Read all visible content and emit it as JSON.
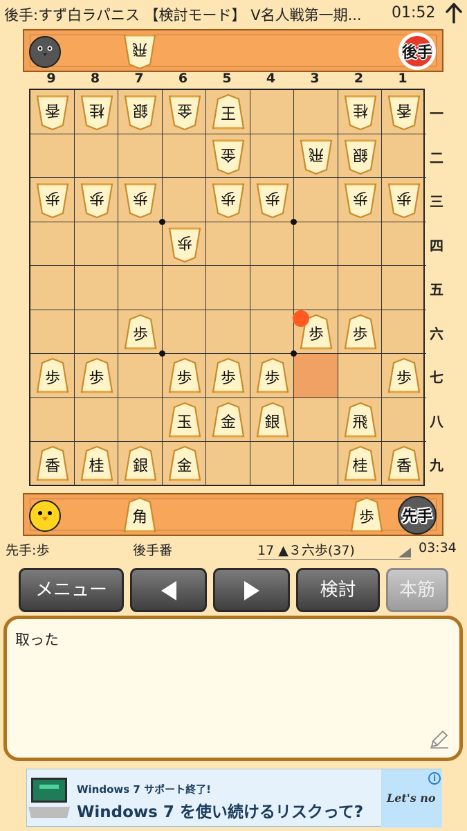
{
  "status_bar": {
    "title": "後手:すず白ラパニス 【検討モード】 V名人戦第一期...",
    "clock": "01:52"
  },
  "gote_hand": {
    "pieces": [
      "飛"
    ],
    "turn_label": "後手"
  },
  "sente_hand": {
    "pieces": [
      "角",
      "歩"
    ],
    "turn_label": "先手"
  },
  "board": {
    "files": [
      "9",
      "8",
      "7",
      "6",
      "5",
      "4",
      "3",
      "2",
      "1"
    ],
    "ranks": [
      "一",
      "二",
      "三",
      "四",
      "五",
      "六",
      "七",
      "八",
      "九"
    ],
    "highlight": {
      "file": 3,
      "rank": 7
    },
    "last_move_marker": {
      "file": 3,
      "rank": 6
    },
    "pieces": [
      {
        "file": 9,
        "rank": 1,
        "kanji": "香",
        "side": "gote"
      },
      {
        "file": 8,
        "rank": 1,
        "kanji": "桂",
        "side": "gote"
      },
      {
        "file": 7,
        "rank": 1,
        "kanji": "銀",
        "side": "gote"
      },
      {
        "file": 6,
        "rank": 1,
        "kanji": "金",
        "side": "gote"
      },
      {
        "file": 5,
        "rank": 1,
        "kanji": "王",
        "side": "sente"
      },
      {
        "file": 2,
        "rank": 1,
        "kanji": "桂",
        "side": "gote"
      },
      {
        "file": 1,
        "rank": 1,
        "kanji": "香",
        "side": "gote"
      },
      {
        "file": 5,
        "rank": 2,
        "kanji": "金",
        "side": "gote"
      },
      {
        "file": 3,
        "rank": 2,
        "kanji": "飛",
        "side": "gote"
      },
      {
        "file": 2,
        "rank": 2,
        "kanji": "銀",
        "side": "gote"
      },
      {
        "file": 9,
        "rank": 3,
        "kanji": "歩",
        "side": "gote"
      },
      {
        "file": 8,
        "rank": 3,
        "kanji": "歩",
        "side": "gote"
      },
      {
        "file": 7,
        "rank": 3,
        "kanji": "歩",
        "side": "gote"
      },
      {
        "file": 5,
        "rank": 3,
        "kanji": "歩",
        "side": "gote"
      },
      {
        "file": 4,
        "rank": 3,
        "kanji": "歩",
        "side": "gote"
      },
      {
        "file": 2,
        "rank": 3,
        "kanji": "歩",
        "side": "gote"
      },
      {
        "file": 1,
        "rank": 3,
        "kanji": "歩",
        "side": "gote"
      },
      {
        "file": 6,
        "rank": 4,
        "kanji": "歩",
        "side": "gote"
      },
      {
        "file": 7,
        "rank": 6,
        "kanji": "歩",
        "side": "sente"
      },
      {
        "file": 3,
        "rank": 6,
        "kanji": "歩",
        "side": "sente"
      },
      {
        "file": 2,
        "rank": 6,
        "kanji": "歩",
        "side": "sente"
      },
      {
        "file": 9,
        "rank": 7,
        "kanji": "歩",
        "side": "sente"
      },
      {
        "file": 8,
        "rank": 7,
        "kanji": "歩",
        "side": "sente"
      },
      {
        "file": 6,
        "rank": 7,
        "kanji": "歩",
        "side": "sente"
      },
      {
        "file": 5,
        "rank": 7,
        "kanji": "歩",
        "side": "sente"
      },
      {
        "file": 4,
        "rank": 7,
        "kanji": "歩",
        "side": "sente"
      },
      {
        "file": 1,
        "rank": 7,
        "kanji": "歩",
        "side": "sente"
      },
      {
        "file": 6,
        "rank": 8,
        "kanji": "玉",
        "side": "sente"
      },
      {
        "file": 5,
        "rank": 8,
        "kanji": "金",
        "side": "sente"
      },
      {
        "file": 4,
        "rank": 8,
        "kanji": "銀",
        "side": "sente"
      },
      {
        "file": 2,
        "rank": 8,
        "kanji": "飛",
        "side": "sente"
      },
      {
        "file": 9,
        "rank": 9,
        "kanji": "香",
        "side": "sente"
      },
      {
        "file": 8,
        "rank": 9,
        "kanji": "桂",
        "side": "sente"
      },
      {
        "file": 7,
        "rank": 9,
        "kanji": "銀",
        "side": "sente"
      },
      {
        "file": 6,
        "rank": 9,
        "kanji": "金",
        "side": "sente"
      },
      {
        "file": 2,
        "rank": 9,
        "kanji": "桂",
        "side": "sente"
      },
      {
        "file": 1,
        "rank": 9,
        "kanji": "香",
        "side": "sente"
      }
    ]
  },
  "info": {
    "sente_hand_text": "先手:歩",
    "turn_text": "後手番",
    "move_text": "17 ▲３六歩(37)",
    "elapsed": "03:34"
  },
  "buttons": {
    "menu": "メニュー",
    "kento": "検討",
    "honsuji": "本筋"
  },
  "comment": {
    "text": "取った"
  },
  "ad": {
    "small": "Windows 7 サポート終了!",
    "big": "Windows 7 を使い続けるリスクって?",
    "brand": "Let's no",
    "info": "i"
  },
  "colors": {
    "accent": "#b07320",
    "last_move": "#ff5a1f",
    "highlight": "#ee8c50"
  }
}
